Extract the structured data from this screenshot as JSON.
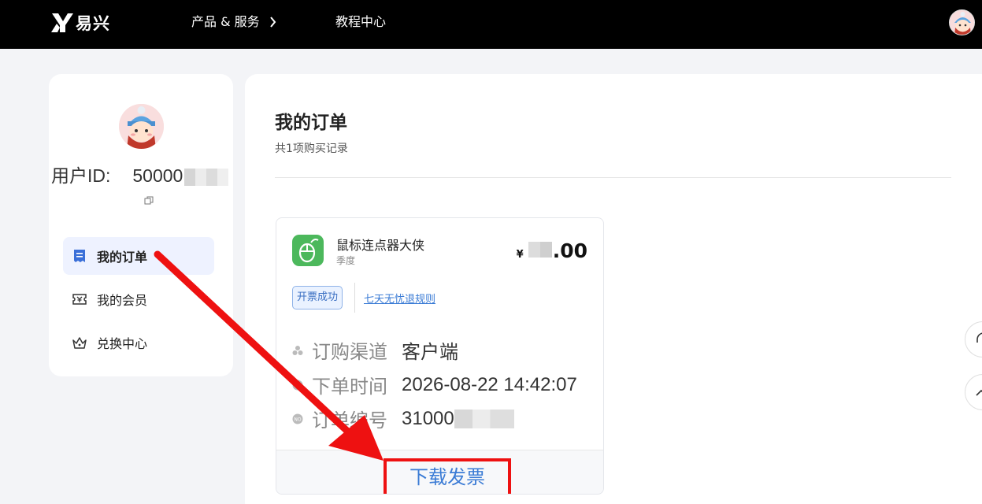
{
  "header": {
    "brand": "易兴",
    "nav": [
      {
        "label": "产品 & 服务"
      },
      {
        "label": "教程中心"
      }
    ]
  },
  "sidebar": {
    "user_id_label": "用户ID:",
    "user_id_visible": "50000",
    "items": [
      {
        "label": "我的订单",
        "icon": "receipt-icon",
        "active": true
      },
      {
        "label": "我的会员",
        "icon": "ticket-icon",
        "active": false
      },
      {
        "label": "兑换中心",
        "icon": "crown-icon",
        "active": false
      }
    ]
  },
  "main": {
    "title": "我的订单",
    "subtitle": "共1项购买记录",
    "order": {
      "product_name": "鼠标连点器大侠",
      "plan": "季度",
      "currency": "¥",
      "price_suffix": ".00",
      "status_tag": "开票成功",
      "refund_link": "七天无忧退规则",
      "channel_label": "订购渠道",
      "channel_value": "客户端",
      "time_label": "下单时间",
      "time_value": "2026-08-22 14:42:07",
      "number_label": "订单编号",
      "number_visible": "31000",
      "download_label": "下载发票"
    }
  },
  "colors": {
    "topbar": "#000000",
    "accent_blue": "#3a7bd5",
    "annotation_red": "#ee1111",
    "app_icon_green": "#4cb85c"
  }
}
